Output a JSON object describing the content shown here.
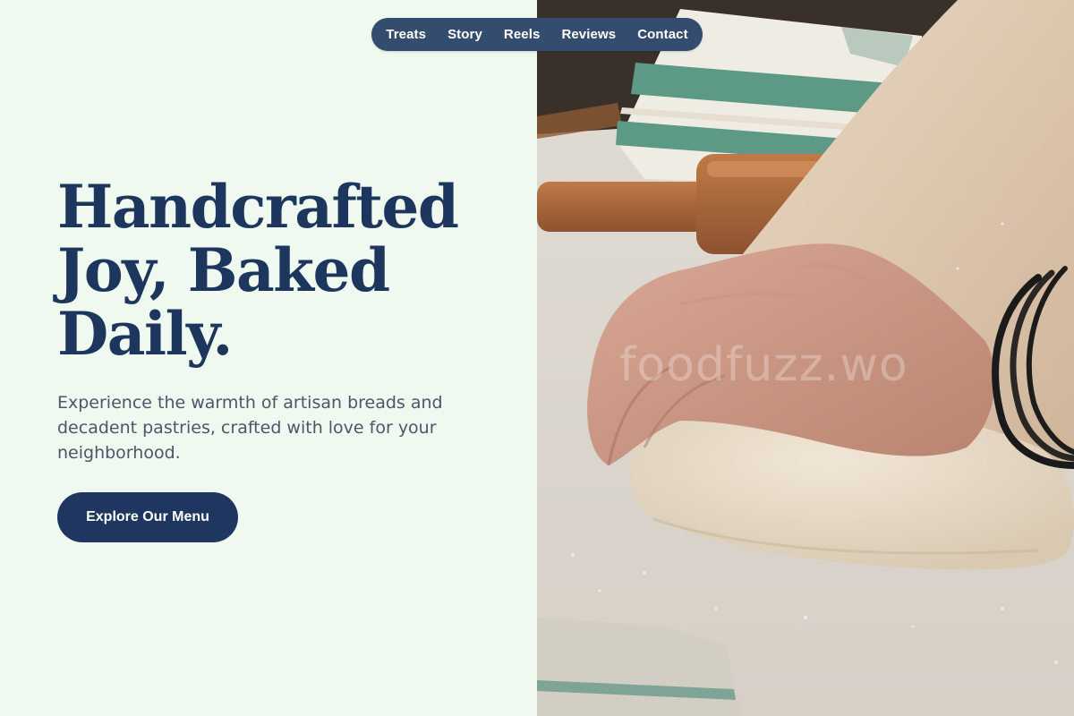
{
  "nav": {
    "items": [
      {
        "label": "Treats"
      },
      {
        "label": "Story"
      },
      {
        "label": "Reels"
      },
      {
        "label": "Reviews"
      },
      {
        "label": "Contact"
      }
    ]
  },
  "hero": {
    "headline_line1": "Handcrafted",
    "headline_line2": "Joy, Baked",
    "headline_line3": "Daily.",
    "description": "Experience the warmth of artisan breads and decadent pastries, crafted with love for your neighborhood.",
    "cta_label": "Explore Our Menu"
  },
  "image": {
    "subject": "hands kneading dough on a floured surface with a rolling pin and striped towel",
    "watermark": "foodfuzz.wo"
  },
  "colors": {
    "background": "#f0f9ef",
    "nav_background": "#344c6d",
    "headline": "#1d365e",
    "body_text": "#4a566a",
    "cta_background": "#1f3760",
    "cta_text": "#ffffff"
  }
}
